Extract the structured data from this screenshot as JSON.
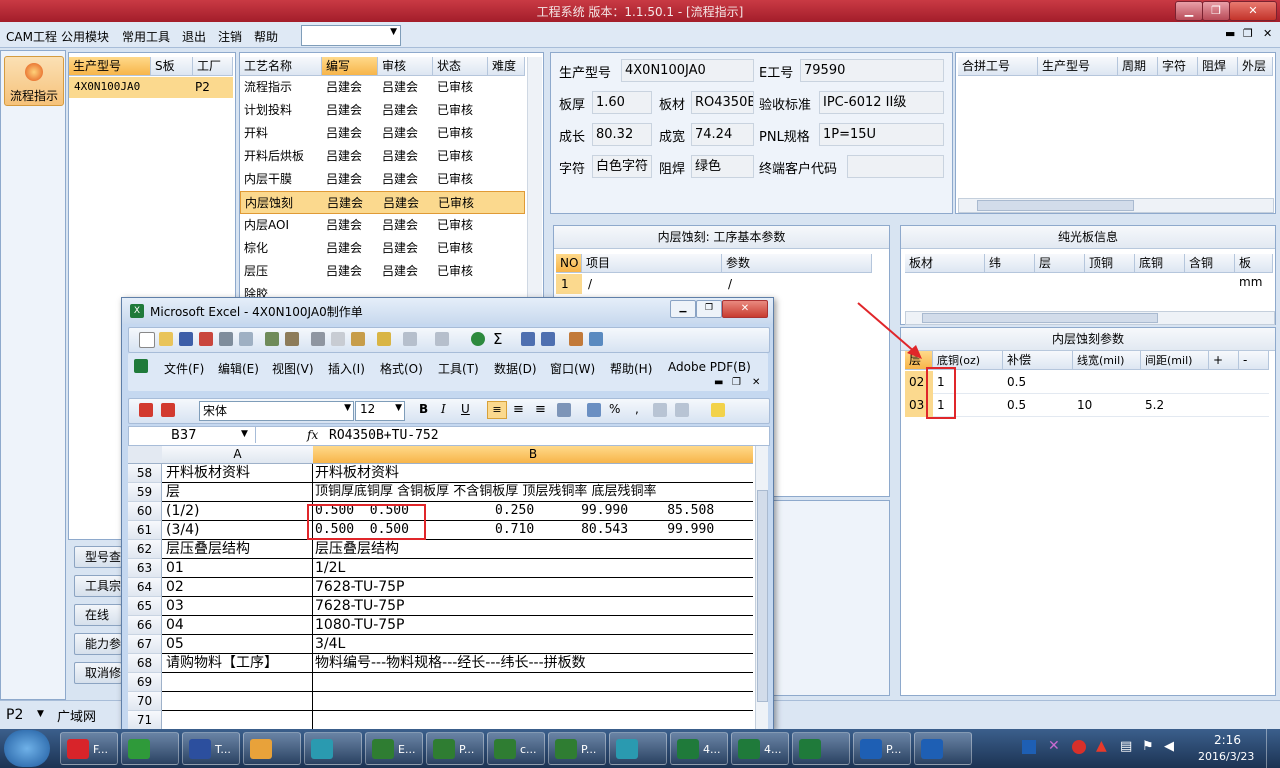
{
  "window": {
    "title": "工程系统   版本：1.1.50.1 - [流程指示]"
  },
  "menubar": {
    "items": [
      "CAM工程",
      "公用模块",
      "常用工具",
      "退出",
      "注销",
      "帮助"
    ],
    "combo_value": ""
  },
  "left_nav": {
    "flow_button": "流程指示",
    "buttons": [
      "型号查",
      "工具宗",
      "在线",
      "能力参",
      "取消修"
    ]
  },
  "model_list": {
    "headers": [
      "生产型号",
      "S板",
      "工厂"
    ],
    "rows": [
      {
        "model": "4X0N100JA0",
        "s": "",
        "factory": "P2"
      }
    ]
  },
  "process": {
    "headers": [
      "工艺名称",
      "编写",
      "审核",
      "状态",
      "难度"
    ],
    "rows": [
      [
        "流程指示",
        "吕建会",
        "吕建会",
        "已审核"
      ],
      [
        "计划投料",
        "吕建会",
        "吕建会",
        "已审核"
      ],
      [
        "开料",
        "吕建会",
        "吕建会",
        "已审核"
      ],
      [
        "开料后烘板",
        "吕建会",
        "吕建会",
        "已审核"
      ],
      [
        "内层干膜",
        "吕建会",
        "吕建会",
        "已审核"
      ],
      [
        "内层蚀刻",
        "吕建会",
        "吕建会",
        "已审核"
      ],
      [
        "内层AOI",
        "吕建会",
        "吕建会",
        "已审核"
      ],
      [
        "棕化",
        "吕建会",
        "吕建会",
        "已审核"
      ],
      [
        "层压",
        "吕建会",
        "吕建会",
        "已审核"
      ],
      [
        "除胶",
        "",
        "",
        ""
      ]
    ]
  },
  "info": {
    "model_label": "生产型号",
    "model": "4X0N100JA0",
    "e_label": "E工号",
    "e": "79590",
    "thick_label": "板厚",
    "thick": "1.60",
    "mat_label": "板材",
    "mat": "RO4350B",
    "std_label": "验收标准",
    "std": "IPC-6012 II级",
    "len_label": "成长",
    "len": "80.32",
    "wid_label": "成宽",
    "wid": "74.24",
    "pnl_label": "PNL规格",
    "pnl": "1P=15U",
    "char_label": "字符",
    "char": "白色字符",
    "mask_label": "阻焊",
    "mask": "绿色",
    "cust_label": "终端客户代码",
    "cust": ""
  },
  "merge_table": {
    "headers": [
      "合拼工号",
      "生产型号",
      "周期",
      "字符",
      "阻焊",
      "外层"
    ]
  },
  "basic_params": {
    "title": "内层蚀刻: 工序基本参数",
    "headers": [
      "NO",
      "项目",
      "参数"
    ],
    "rows": [
      [
        "1",
        "/",
        "/"
      ]
    ]
  },
  "bare_board": {
    "title": "纯光板信息",
    "headers": [
      "板材",
      "纬",
      "层",
      "顶铜",
      "底铜",
      "含铜",
      "板mm"
    ]
  },
  "etch_params": {
    "title": "内层蚀刻参数",
    "headers": [
      "层",
      "底铜(oz)",
      "补偿",
      "线宽(mil)",
      "间距(mil)",
      "+",
      "-"
    ],
    "rows": [
      [
        "02",
        "1",
        "0.5",
        "",
        ""
      ],
      [
        "03",
        "1",
        "0.5",
        "10",
        "5.2"
      ]
    ]
  },
  "statusbar": {
    "factory": "P2",
    "network": "广域网"
  },
  "excel": {
    "title": "Microsoft Excel - 4X0N100JA0制作单",
    "menu": [
      "文件(F)",
      "编辑(E)",
      "视图(V)",
      "插入(I)",
      "格式(O)",
      "工具(T)",
      "数据(D)",
      "窗口(W)",
      "帮助(H)",
      "Adobe PDF(B)"
    ],
    "font": "宋体",
    "font_size": "12",
    "cell_ref": "B37",
    "formula": "RO4350B+TU-752",
    "col_a": "A",
    "col_b": "B",
    "rows": [
      {
        "n": "58",
        "a": "开料板材资料",
        "b": "开料板材资料"
      },
      {
        "n": "59",
        "a": "层",
        "b": "顶铜厚底铜厚 含铜板厚 不含铜板厚 顶层残铜率 底层残铜率"
      },
      {
        "n": "60",
        "a": "(1/2)",
        "b": "0.500  0.500           0.250      99.990     85.508"
      },
      {
        "n": "61",
        "a": "(3/4)",
        "b": "0.500  0.500           0.710      80.543     99.990"
      },
      {
        "n": "62",
        "a": "层压叠层结构",
        "b": "层压叠层结构"
      },
      {
        "n": "63",
        "a": "01",
        "b": "1/2L"
      },
      {
        "n": "64",
        "a": "02",
        "b": "7628-TU-75P"
      },
      {
        "n": "65",
        "a": "03",
        "b": "7628-TU-75P"
      },
      {
        "n": "66",
        "a": "04",
        "b": "1080-TU-75P"
      },
      {
        "n": "67",
        "a": "05",
        "b": "3/4L"
      },
      {
        "n": "68",
        "a": "请购物料【工序】",
        "b": "物料编号---物料规格---经长---纬长---拼板数"
      },
      {
        "n": "69",
        "a": "",
        "b": ""
      },
      {
        "n": "70",
        "a": "",
        "b": ""
      },
      {
        "n": "71",
        "a": "",
        "b": ""
      }
    ]
  },
  "taskbar": {
    "items": [
      {
        "label": "F...",
        "color": "#d8242a"
      },
      {
        "label": "",
        "color": "#2f9a3a"
      },
      {
        "label": "T...",
        "color": "#2c4f9e"
      },
      {
        "label": "",
        "color": "#e8a23a"
      },
      {
        "label": "",
        "color": "#2a9ab0"
      },
      {
        "label": "E...",
        "color": "#2f7d32"
      },
      {
        "label": "P...",
        "color": "#2f7d32"
      },
      {
        "label": "c...",
        "color": "#2f7d32"
      },
      {
        "label": "P...",
        "color": "#2f7d32"
      },
      {
        "label": "",
        "color": "#2a9ab0"
      },
      {
        "label": "4...",
        "color": "#1f7a3a"
      },
      {
        "label": "4...",
        "color": "#1f7a3a"
      },
      {
        "label": "",
        "color": "#1f7a3a"
      },
      {
        "label": "P...",
        "color": "#1e5fb4"
      },
      {
        "label": "",
        "color": "#1e5fb4"
      }
    ],
    "time": "2:16",
    "date": "2016/3/23"
  }
}
